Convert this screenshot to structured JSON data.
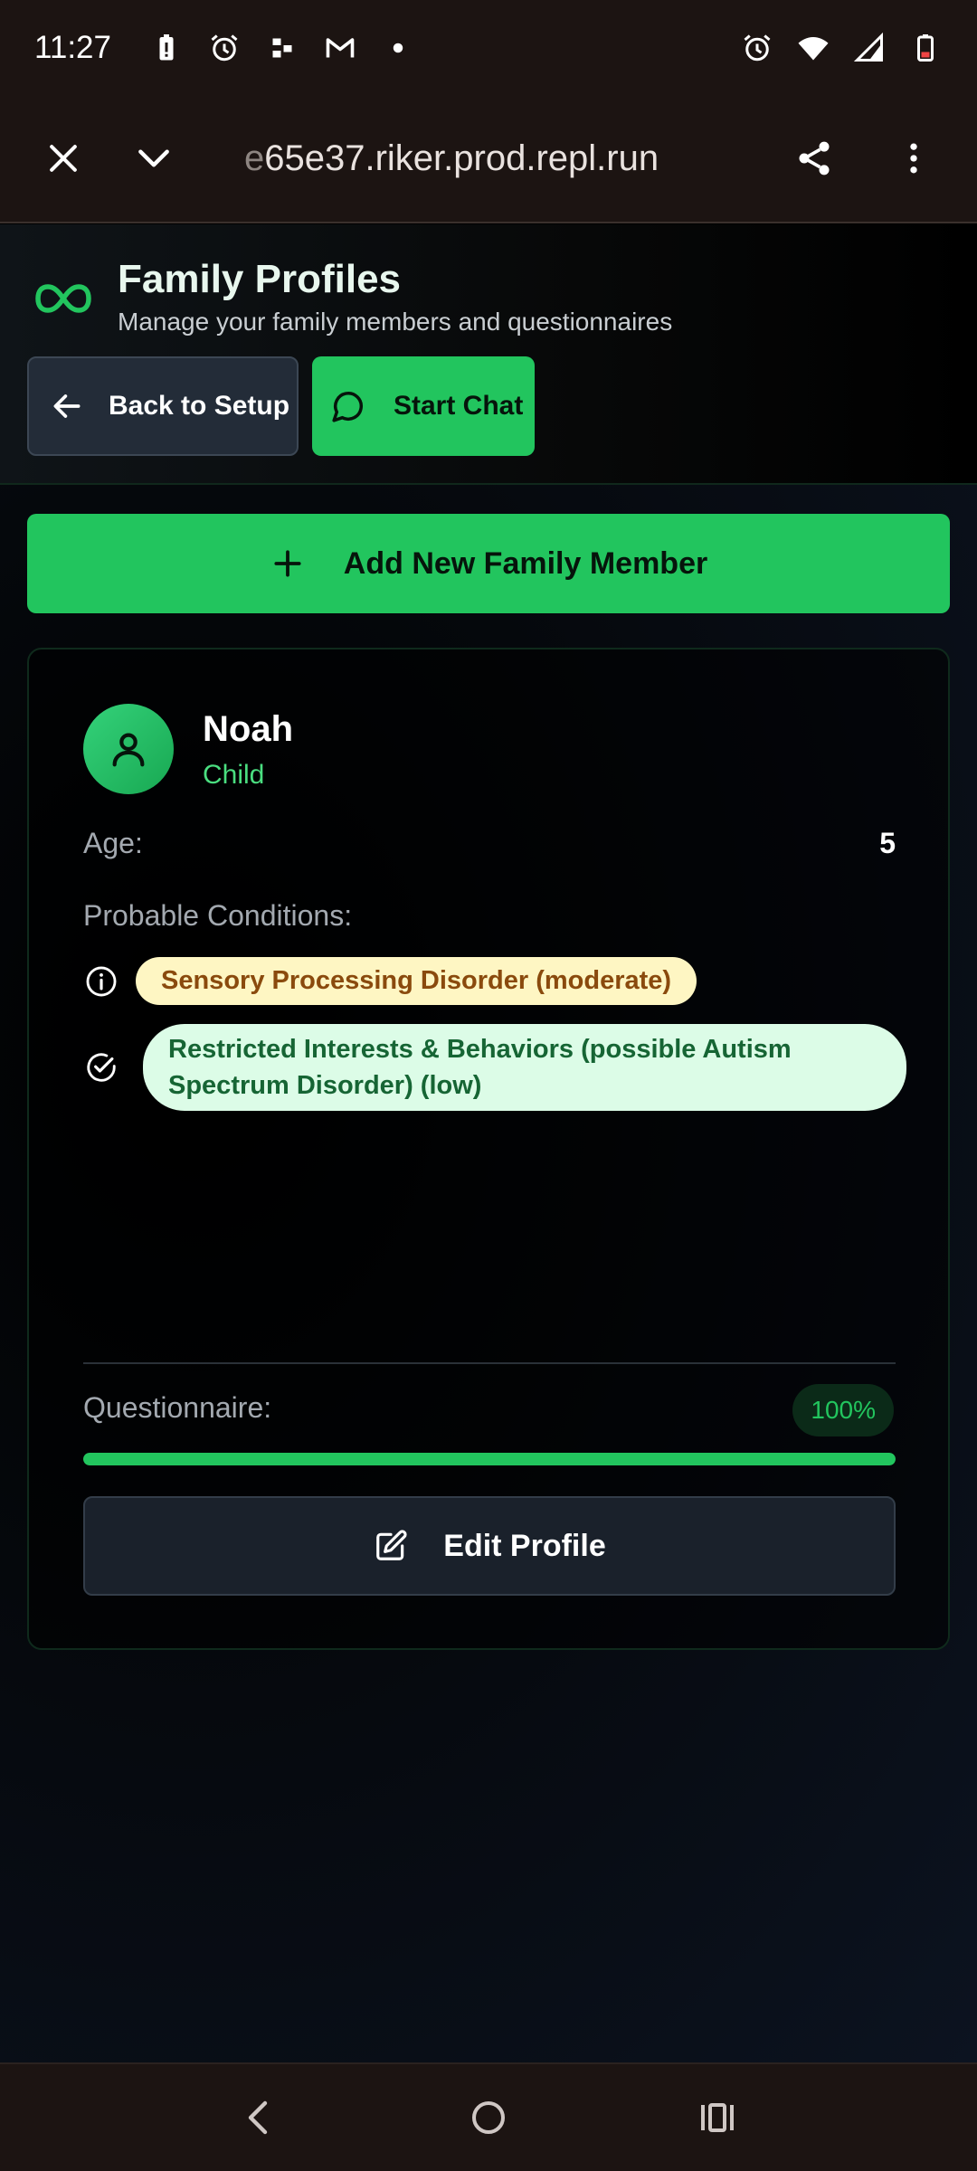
{
  "status_bar": {
    "time": "11:27"
  },
  "browser": {
    "url_fade": "e",
    "url_main": "65e37.riker.prod.repl.run"
  },
  "header": {
    "title": "Family Profiles",
    "subtitle": "Manage your family members and questionnaires",
    "back_label": "Back to Setup",
    "chat_label": "Start Chat"
  },
  "actions": {
    "add_member_label": "Add New Family Member"
  },
  "member": {
    "name": "Noah",
    "role": "Child",
    "age_label": "Age:",
    "age_value": "5",
    "conditions_heading": "Probable Conditions:",
    "conditions": [
      {
        "text": "Sensory Processing Disorder (moderate)",
        "severity": "moderate",
        "icon": "info-icon"
      },
      {
        "text": "Restricted Interests & Behaviors (possible Autism Spectrum Disorder) (low)",
        "severity": "low",
        "icon": "check-circle-icon"
      }
    ],
    "questionnaire_label": "Questionnaire:",
    "questionnaire_percent": "100%",
    "questionnaire_progress": 1.0,
    "edit_label": "Edit Profile"
  },
  "colors": {
    "accent": "#22c55e",
    "accent_light": "#4ade80",
    "moderate_bg": "#fef6c3",
    "moderate_text": "#8a4a0d",
    "low_bg": "#dcfce7",
    "low_text": "#166534"
  }
}
